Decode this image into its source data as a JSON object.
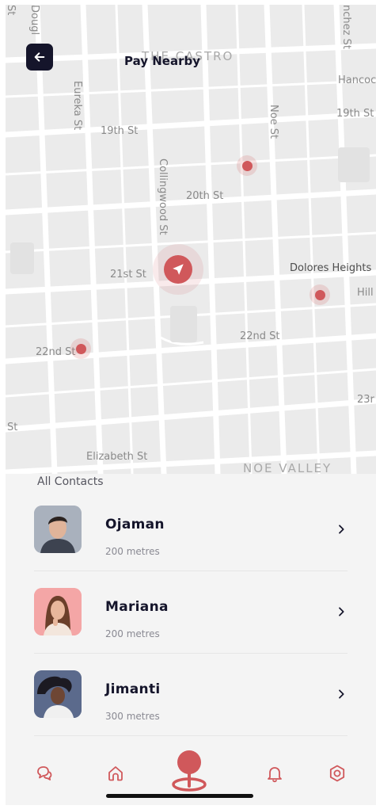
{
  "header": {
    "title": "Pay Nearby",
    "back_icon": "arrow-left-icon"
  },
  "map": {
    "labels": {
      "the_castro": "THE CASTRO",
      "noe_valley": "NOE VALLEY",
      "dolores_heights": "Dolores Heights",
      "st_19": "19th St",
      "st_19_right": "19th St",
      "st_20": "20th St",
      "st_21": "21st St",
      "st_22_left": "22nd St",
      "st_22_mid": "22nd St",
      "st_23": "23r",
      "elizabeth": "Elizabeth St",
      "st_left": "St",
      "hill": "Hill",
      "hancock": "Hancoc",
      "eureka": "Eureka St",
      "collingwood": "Collingwood St",
      "noe": "Noe St",
      "douglass": "Dougl",
      "sanchez": "nchez St",
      "top_left_st": "St"
    },
    "current_location_icon": "navigation-arrow-icon",
    "colors": {
      "accent": "#d0585b",
      "dark": "#15152b"
    }
  },
  "contacts": {
    "section_title": "All Contacts",
    "items": [
      {
        "name": "Ojaman",
        "distance": "200 metres",
        "avatar_bg": "#a9b1bd"
      },
      {
        "name": "Mariana",
        "distance": "200 metres",
        "avatar_bg": "#f4a6a6"
      },
      {
        "name": "Jimanti",
        "distance": "300 metres",
        "avatar_bg": "#5b6a8c"
      }
    ],
    "chevron_icon": "chevron-right-icon"
  },
  "bottom_nav": {
    "items": [
      {
        "icon": "chat-icon"
      },
      {
        "icon": "home-icon"
      },
      {
        "icon": "location-pin-icon",
        "active": true
      },
      {
        "icon": "bell-icon"
      },
      {
        "icon": "settings-icon"
      }
    ]
  }
}
